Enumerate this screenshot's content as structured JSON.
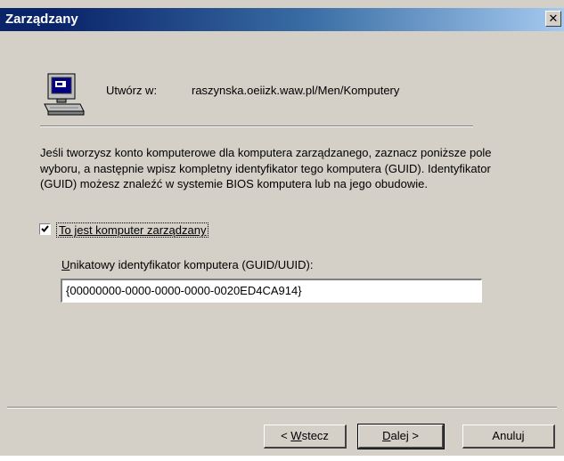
{
  "window": {
    "title": "Zarządzany",
    "close_glyph": "✕"
  },
  "header": {
    "create_in_label": "Utwórz w:",
    "create_in_path": "raszynska.oeiizk.waw.pl/Men/Komputery",
    "icon": "computer-icon"
  },
  "description": "Jeśli tworzysz konto komputerowe dla  komputera zarządzanego, zaznacz poniższe pole wyboru, a następnie wpisz kompletny identyfikator tego komputera (GUID). Identyfikator (GUID) możesz znaleźć w systemie BIOS komputera lub na jego obudowie.",
  "managed_checkbox": {
    "label": "To jest komputer zarządzany",
    "checked": true
  },
  "guid": {
    "label_mnemonic": "U",
    "label_rest": "nikatowy identyfikator komputera (GUID/UUID):",
    "value": "{00000000-0000-0000-0000-0020ED4CA914}"
  },
  "buttons": {
    "back": {
      "prefix": "< ",
      "mnemonic": "W",
      "rest": "stecz"
    },
    "next": {
      "mnemonic": "D",
      "rest": "alej >"
    },
    "cancel": "Anuluj"
  }
}
